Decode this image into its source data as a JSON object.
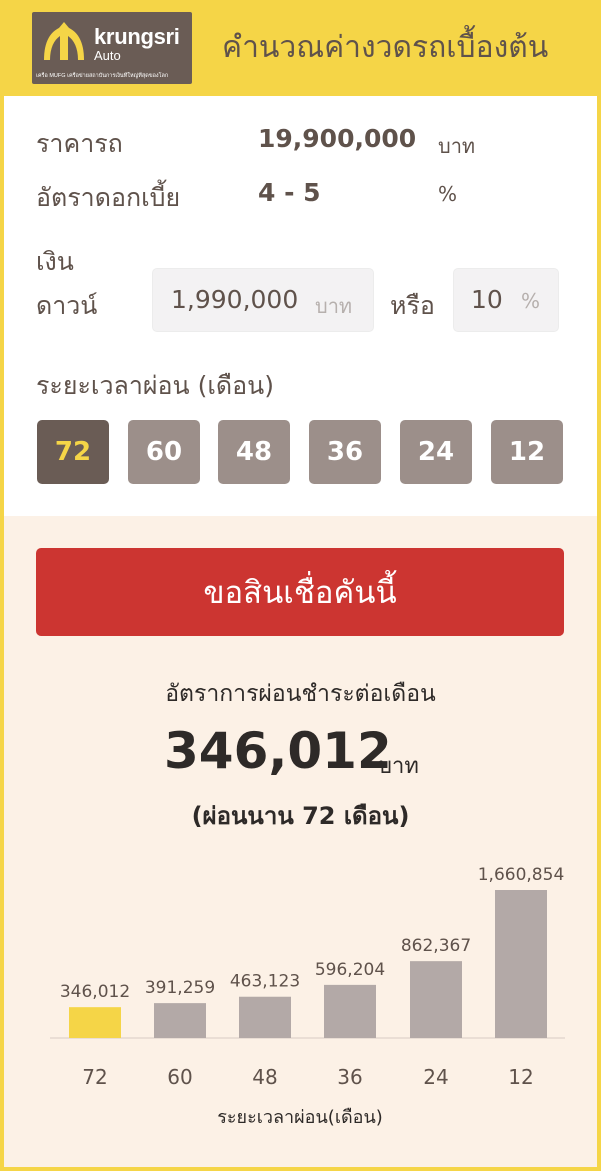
{
  "header": {
    "logo_text": "krungsri",
    "logo_sub": "Auto",
    "logo_tagline": "เครือ MUFG เครือข่ายสถาบันการเงินที่ใหญ่ที่สุดของโลก",
    "title": "คำนวณค่างวดรถเบื้องต้น"
  },
  "form": {
    "price": {
      "label": "ราคารถ",
      "value": "19,900,000",
      "unit": "บาท"
    },
    "interest": {
      "label": "อัตราดอกเบี้ย",
      "value": "4 - 5",
      "unit": "%"
    },
    "down_payment": {
      "label_line1": "เงิน",
      "label_line2": "ดาวน์",
      "amount": "1,990,000",
      "amount_unit": "บาท",
      "or": "หรือ",
      "percent": "10",
      "percent_unit": "%"
    },
    "term": {
      "label": "ระยะเวลาผ่อน (เดือน)",
      "options": [
        "72",
        "60",
        "48",
        "36",
        "24",
        "12"
      ],
      "selected": "72"
    }
  },
  "apply_button": "ขอสินเชื่อคันนี้",
  "result": {
    "label": "อัตราการผ่อนชำระต่อเดือน",
    "amount": "346,012",
    "unit": "บาท",
    "term_text": "(ผ่อนนาน 72 เดือน)"
  },
  "colors": {
    "brand_yellow": "#f5d547",
    "brand_brown": "#6a5c55",
    "button_gray": "#9c8f8a",
    "apply_red": "#cc3531",
    "bar_gray": "#b3a9a7",
    "bar_active": "#f5d547",
    "panel_bg": "#fcf1e6"
  },
  "chart_data": {
    "type": "bar",
    "categories": [
      "72",
      "60",
      "48",
      "36",
      "24",
      "12"
    ],
    "values": [
      346012,
      391259,
      463123,
      596204,
      862367,
      1660854
    ],
    "value_labels": [
      "346,012",
      "391,259",
      "463,123",
      "596,204",
      "862,367",
      "1,660,854"
    ],
    "highlight_index": 0,
    "xlabel": "ระยะเวลาผ่อน(เดือน)",
    "ylabel": "",
    "ylim": [
      0,
      1660854
    ],
    "grid": false
  }
}
